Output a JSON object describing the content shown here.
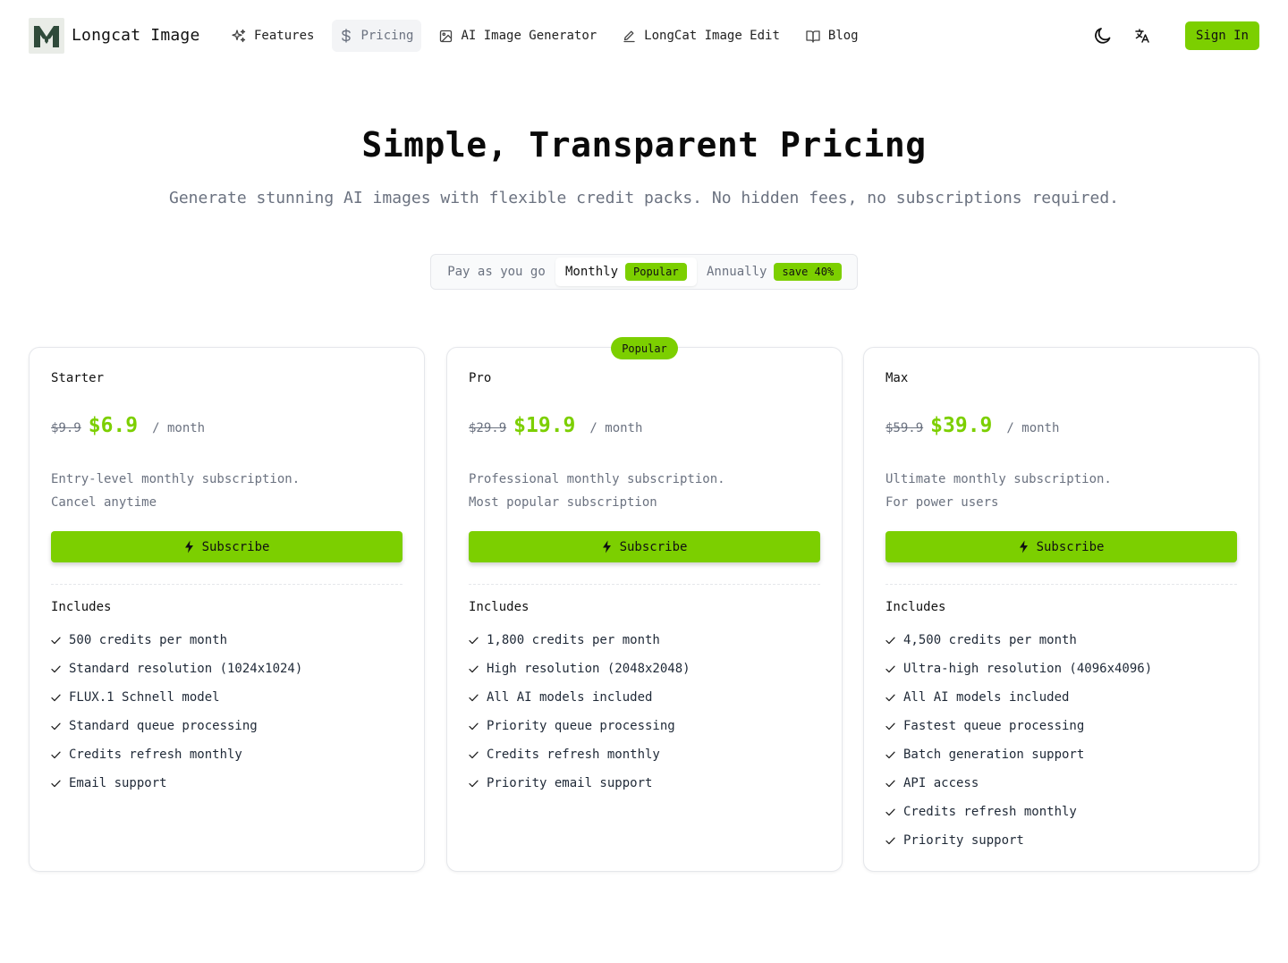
{
  "brand": {
    "name": "Longcat Image"
  },
  "nav": {
    "items": [
      {
        "label": "Features",
        "icon": "sparkles-icon"
      },
      {
        "label": "Pricing",
        "icon": "dollar-icon",
        "active": true
      },
      {
        "label": "AI Image Generator",
        "icon": "image-icon"
      },
      {
        "label": "LongCat Image Edit",
        "icon": "pencil-icon"
      },
      {
        "label": "Blog",
        "icon": "book-open-icon"
      }
    ],
    "signin_label": "Sign In"
  },
  "hero": {
    "title": "Simple, Transparent Pricing",
    "subtitle": "Generate stunning AI images with flexible credit packs. No hidden fees, no subscriptions required."
  },
  "billing": {
    "options": [
      {
        "label": "Pay as you go",
        "badge": ""
      },
      {
        "label": "Monthly",
        "badge": "Popular",
        "active": true
      },
      {
        "label": "Annually",
        "badge": "save 40%"
      }
    ]
  },
  "plans": [
    {
      "name": "Starter",
      "old_price": "$9.9",
      "price": "$6.9",
      "period": "/ month",
      "desc_line1": "Entry-level monthly subscription.",
      "desc_line2": "Cancel anytime",
      "button_label": "Subscribe",
      "includes_label": "Includes",
      "features": [
        "500 credits per month",
        "Standard resolution (1024x1024)",
        "FLUX.1 Schnell model",
        "Standard queue processing",
        "Credits refresh monthly",
        "Email support"
      ]
    },
    {
      "name": "Pro",
      "badge": "Popular",
      "old_price": "$29.9",
      "price": "$19.9",
      "period": "/ month",
      "desc_line1": "Professional monthly subscription.",
      "desc_line2": "Most popular subscription",
      "button_label": "Subscribe",
      "includes_label": "Includes",
      "features": [
        "1,800 credits per month",
        "High resolution (2048x2048)",
        "All AI models included",
        "Priority queue processing",
        "Credits refresh monthly",
        "Priority email support"
      ]
    },
    {
      "name": "Max",
      "old_price": "$59.9",
      "price": "$39.9",
      "period": "/ month",
      "desc_line1": "Ultimate monthly subscription.",
      "desc_line2": "For power users",
      "button_label": "Subscribe",
      "includes_label": "Includes",
      "features": [
        "4,500 credits per month",
        "Ultra-high resolution (4096x4096)",
        "All AI models included",
        "Fastest queue processing",
        "Batch generation support",
        "API access",
        "Credits refresh monthly",
        "Priority support"
      ]
    }
  ],
  "colors": {
    "accent": "#7ccf00",
    "muted_text": "#6b7280",
    "border": "#e5e7eb"
  }
}
